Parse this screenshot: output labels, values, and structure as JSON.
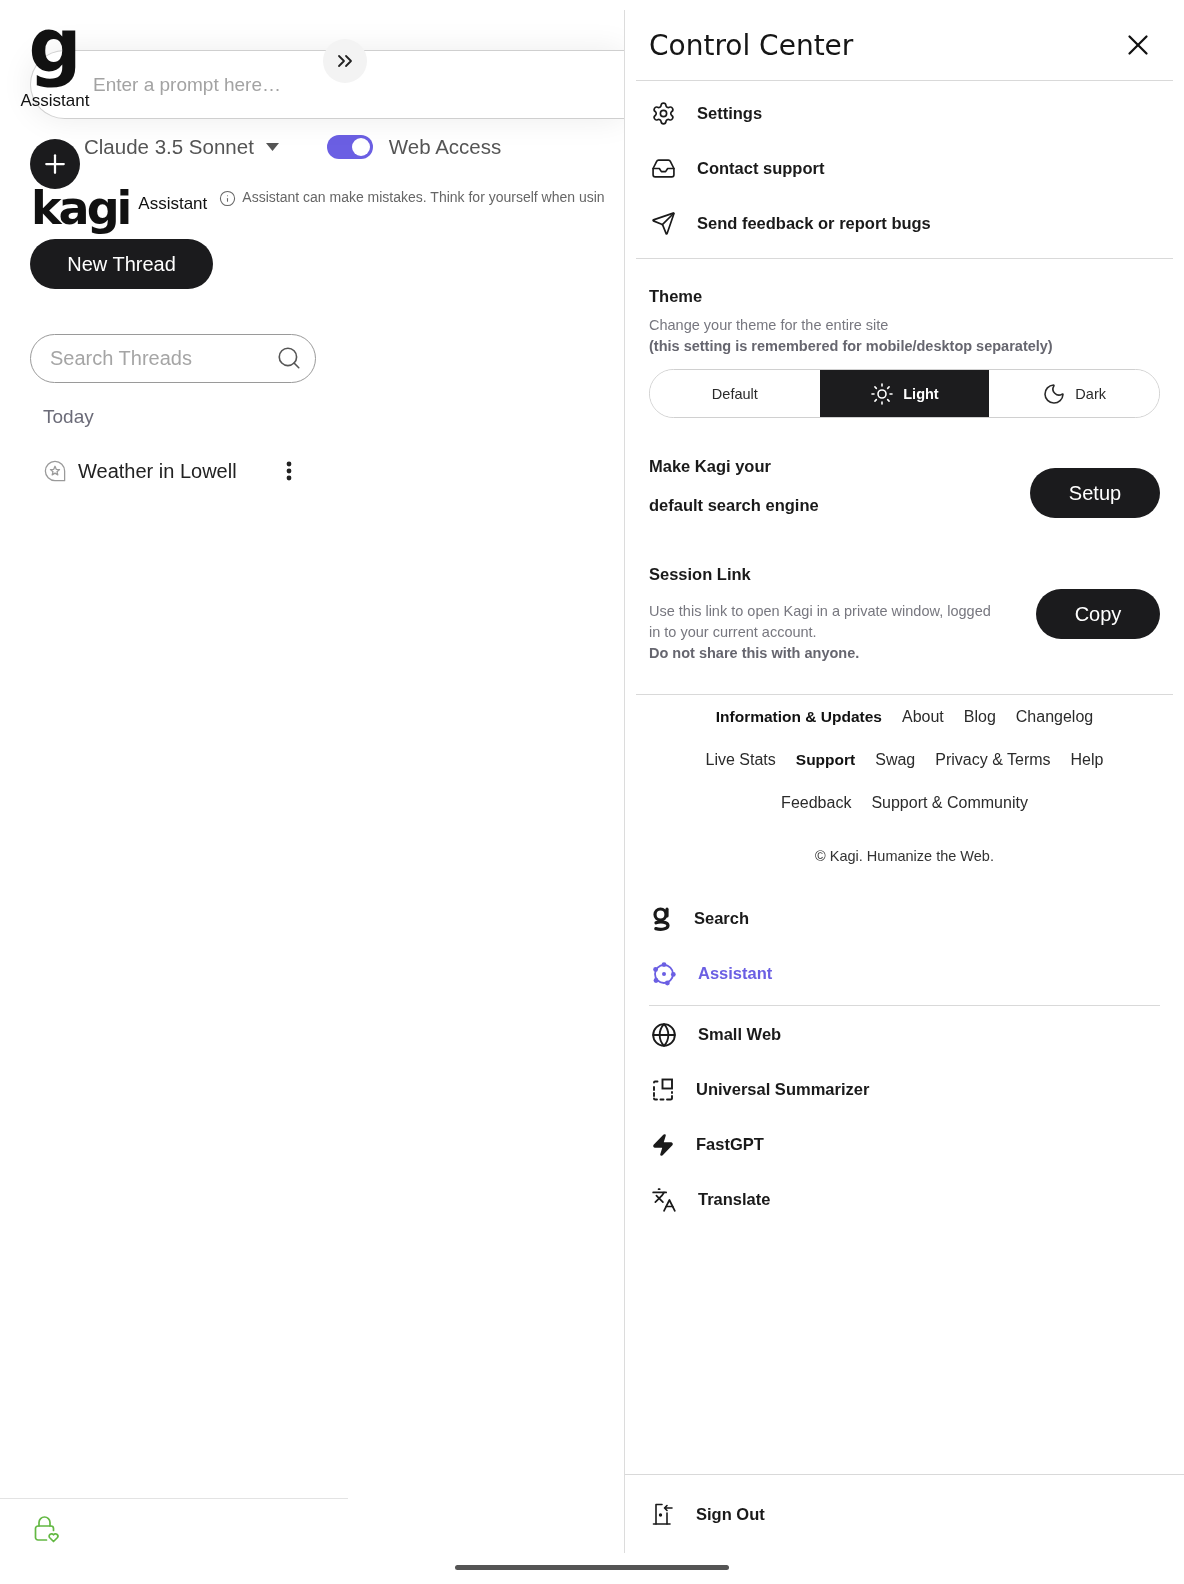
{
  "assistant_brand": {
    "mark": "g",
    "label": "Assistant"
  },
  "prompt": {
    "placeholder": "Enter a prompt here…"
  },
  "model_selector": {
    "value": "Claude 3.5 Sonnet"
  },
  "web_access": {
    "label": "Web Access",
    "on": true
  },
  "logo": {
    "wordmark": "kagi",
    "caption": "Assistant"
  },
  "notice": "Assistant can make mistakes. Think for yourself when usin",
  "new_thread_button": "New Thread",
  "thread_search": {
    "placeholder": "Search Threads"
  },
  "thread_groups": [
    {
      "label": "Today",
      "threads": [
        {
          "title": "Weather in Lowell"
        }
      ]
    }
  ],
  "control_center": {
    "title": "Control Center",
    "menu": [
      {
        "kind": "settings",
        "label": "Settings"
      },
      {
        "kind": "support",
        "label": "Contact support"
      },
      {
        "kind": "feedback",
        "label": "Send feedback or report bugs"
      }
    ],
    "theme": {
      "title": "Theme",
      "description": "Change your theme for the entire site",
      "note": "(this setting is remembered for mobile/desktop separately)",
      "options": [
        {
          "kind": "default",
          "label": "Default",
          "selected": false
        },
        {
          "kind": "light",
          "label": "Light",
          "selected": true
        },
        {
          "kind": "dark",
          "label": "Dark",
          "selected": false
        }
      ]
    },
    "default_engine": {
      "text": "Make Kagi your default search engine",
      "button": "Setup"
    },
    "session_link": {
      "title": "Session Link",
      "description": "Use this link to open Kagi in a private window, logged in to your current account.",
      "warning": "Do not share this with anyone.",
      "button": "Copy"
    },
    "footer": {
      "groups": [
        {
          "heading": "Information & Updates",
          "links": [
            "About",
            "Blog",
            "Changelog",
            "Live Stats"
          ]
        },
        {
          "heading": "Support",
          "links": [
            "Swag",
            "Privacy & Terms",
            "Help",
            "Feedback",
            "Support & Community"
          ]
        }
      ],
      "copyright": "© Kagi. Humanize the Web."
    },
    "service_groups": [
      {
        "items": [
          {
            "kind": "search",
            "label": "Search",
            "selected": false
          },
          {
            "kind": "assistant",
            "label": "Assistant",
            "selected": true
          }
        ]
      },
      {
        "items": [
          {
            "kind": "small_web",
            "label": "Small Web",
            "selected": false
          },
          {
            "kind": "summarizer",
            "label": "Universal Summarizer",
            "selected": false
          },
          {
            "kind": "fastgpt",
            "label": "FastGPT",
            "selected": false
          },
          {
            "kind": "translate",
            "label": "Translate",
            "selected": false
          }
        ]
      }
    ],
    "sign_out": "Sign Out"
  }
}
